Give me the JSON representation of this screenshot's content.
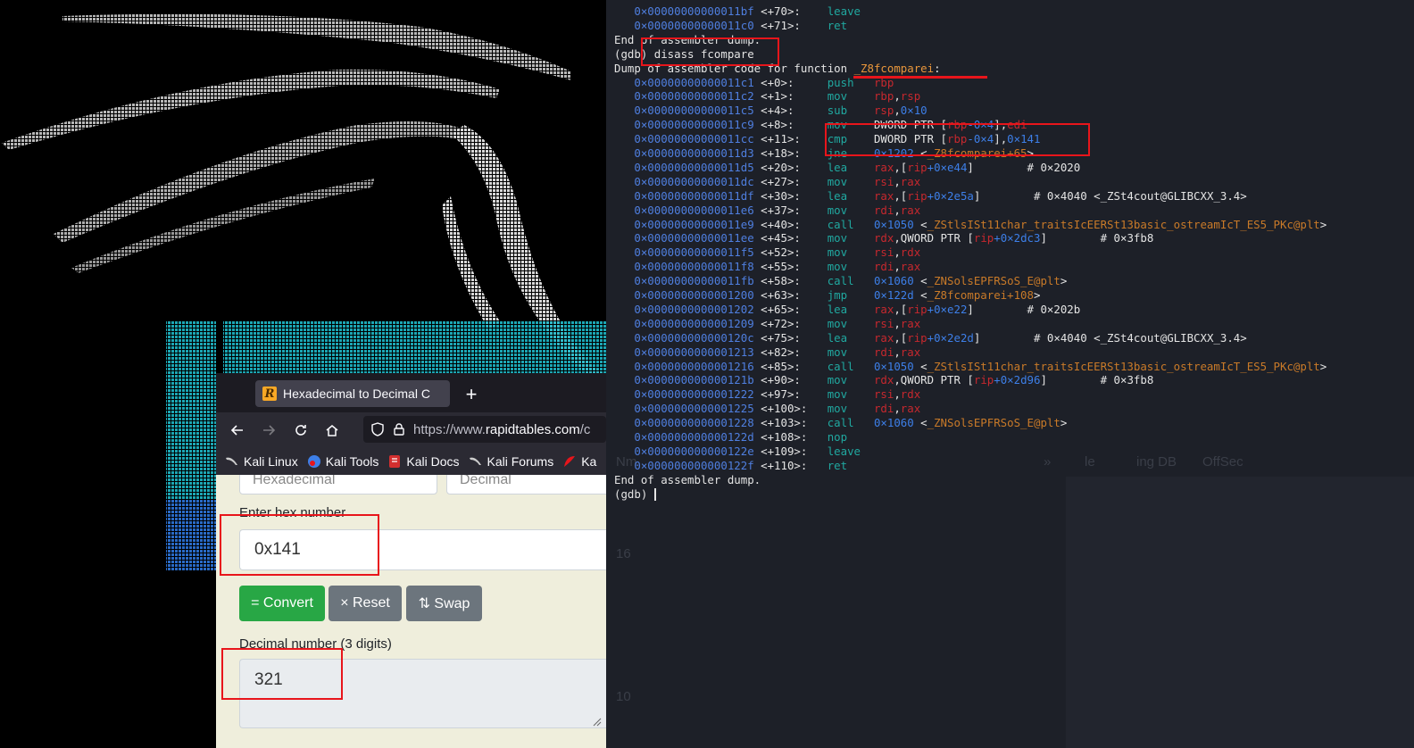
{
  "browser": {
    "tab_title": "Hexadecimal to Decimal C",
    "tab_favicon": "R",
    "new_tab_icon": "+",
    "url_prefix": "https://www.",
    "url_domain": "rapidtables.com",
    "url_rest": "/c",
    "bookmarks": [
      {
        "label": "Kali Linux",
        "icon": "kali-dragon-icon"
      },
      {
        "label": "Kali Tools",
        "icon": "kali-tools-icon"
      },
      {
        "label": "Kali Docs",
        "icon": "kali-docs-icon"
      },
      {
        "label": "Kali Forums",
        "icon": "kali-dragon-icon"
      },
      {
        "label": "Ka",
        "icon": "offsec-icon"
      }
    ]
  },
  "converter": {
    "from_select": "Hexadecimal",
    "to_select": "Decimal",
    "hex_label": "Enter hex number",
    "hex_value": "0x141",
    "convert_label": "= Convert",
    "reset_label": "× Reset",
    "swap_label": "⇅ Swap",
    "decimal_label": "Decimal number (3 digits)",
    "decimal_value": "321"
  },
  "terminal": {
    "ghost_items": {
      "item1": "Nm",
      "item2": "le",
      "item3": "ing DB",
      "item4": "OffSec",
      "item5": "»",
      "num1": "16",
      "num2": "10"
    },
    "lines": [
      [
        [
          "addr",
          "   0×00000000000011bf"
        ],
        [
          "off",
          " <+70>:    "
        ],
        [
          "mn",
          "leave"
        ]
      ],
      [
        [
          "addr",
          "   0×00000000000011c0"
        ],
        [
          "off",
          " <+71>:    "
        ],
        [
          "mn",
          "ret"
        ]
      ],
      [
        [
          "w",
          "End of assembler dump."
        ]
      ],
      [
        [
          "w",
          "(gdb) disass fcompare"
        ]
      ],
      [
        [
          "w",
          "Dump of assembler code for function "
        ],
        [
          "fn",
          "_Z8fcomparei"
        ],
        [
          "w",
          ":"
        ]
      ],
      [
        [
          "addr",
          "   0×00000000000011c1"
        ],
        [
          "off",
          " <+0>:     "
        ],
        [
          "mn",
          "push   "
        ],
        [
          "reg",
          "rbp"
        ]
      ],
      [
        [
          "addr",
          "   0×00000000000011c2"
        ],
        [
          "off",
          " <+1>:     "
        ],
        [
          "mn",
          "mov    "
        ],
        [
          "reg",
          "rbp"
        ],
        [
          "w",
          ","
        ],
        [
          "reg",
          "rsp"
        ]
      ],
      [
        [
          "addr",
          "   0×00000000000011c5"
        ],
        [
          "off",
          " <+4>:     "
        ],
        [
          "mn",
          "sub    "
        ],
        [
          "reg",
          "rsp"
        ],
        [
          "w",
          ","
        ],
        [
          "num",
          "0×10"
        ]
      ],
      [
        [
          "addr",
          "   0×00000000000011c9"
        ],
        [
          "off",
          " <+8>:     "
        ],
        [
          "mn",
          "mov    "
        ],
        [
          "w",
          "DWORD PTR ["
        ],
        [
          "reg",
          "rbp"
        ],
        [
          "num",
          "-0×4"
        ],
        [
          "w",
          "],"
        ],
        [
          "reg",
          "edi"
        ]
      ],
      [
        [
          "addr",
          "   0×00000000000011cc"
        ],
        [
          "off",
          " <+11>:    "
        ],
        [
          "mn",
          "cmp    "
        ],
        [
          "w",
          "DWORD PTR ["
        ],
        [
          "reg",
          "rbp"
        ],
        [
          "num",
          "-0×4"
        ],
        [
          "w",
          "],"
        ],
        [
          "num",
          "0×141"
        ]
      ],
      [
        [
          "addr",
          "   0×00000000000011d3"
        ],
        [
          "off",
          " <+18>:    "
        ],
        [
          "mn",
          "jne    "
        ],
        [
          "num",
          "0×1202 "
        ],
        [
          "w",
          "<"
        ],
        [
          "sym",
          "_Z8fcomparei+65"
        ],
        [
          "w",
          ">"
        ]
      ],
      [
        [
          "addr",
          "   0×00000000000011d5"
        ],
        [
          "off",
          " <+20>:    "
        ],
        [
          "mn",
          "lea    "
        ],
        [
          "reg",
          "rax"
        ],
        [
          "w",
          ",["
        ],
        [
          "reg",
          "rip"
        ],
        [
          "num",
          "+0×e44"
        ],
        [
          "w",
          "]        "
        ],
        [
          "cm",
          "# 0×2020"
        ]
      ],
      [
        [
          "addr",
          "   0×00000000000011dc"
        ],
        [
          "off",
          " <+27>:    "
        ],
        [
          "mn",
          "mov    "
        ],
        [
          "reg",
          "rsi"
        ],
        [
          "w",
          ","
        ],
        [
          "reg",
          "rax"
        ]
      ],
      [
        [
          "addr",
          "   0×00000000000011df"
        ],
        [
          "off",
          " <+30>:    "
        ],
        [
          "mn",
          "lea    "
        ],
        [
          "reg",
          "rax"
        ],
        [
          "w",
          ",["
        ],
        [
          "reg",
          "rip"
        ],
        [
          "num",
          "+0×2e5a"
        ],
        [
          "w",
          "]        "
        ],
        [
          "cm",
          "# 0×4040 <_ZSt4cout@GLIBCXX_3.4>"
        ]
      ],
      [
        [
          "addr",
          "   0×00000000000011e6"
        ],
        [
          "off",
          " <+37>:    "
        ],
        [
          "mn",
          "mov    "
        ],
        [
          "reg",
          "rdi"
        ],
        [
          "w",
          ","
        ],
        [
          "reg",
          "rax"
        ]
      ],
      [
        [
          "addr",
          "   0×00000000000011e9"
        ],
        [
          "off",
          " <+40>:    "
        ],
        [
          "mn",
          "call   "
        ],
        [
          "num",
          "0×1050 "
        ],
        [
          "w",
          "<"
        ],
        [
          "sym",
          "_ZStlsISt11char_traitsIcEERSt13basic_ostreamIcT_ES5_PKc@plt"
        ],
        [
          "w",
          ">"
        ]
      ],
      [
        [
          "addr",
          "   0×00000000000011ee"
        ],
        [
          "off",
          " <+45>:    "
        ],
        [
          "mn",
          "mov    "
        ],
        [
          "reg",
          "rdx"
        ],
        [
          "w",
          ",QWORD PTR ["
        ],
        [
          "reg",
          "rip"
        ],
        [
          "num",
          "+0×2dc3"
        ],
        [
          "w",
          "]        "
        ],
        [
          "cm",
          "# 0×3fb8"
        ]
      ],
      [
        [
          "addr",
          "   0×00000000000011f5"
        ],
        [
          "off",
          " <+52>:    "
        ],
        [
          "mn",
          "mov    "
        ],
        [
          "reg",
          "rsi"
        ],
        [
          "w",
          ","
        ],
        [
          "reg",
          "rdx"
        ]
      ],
      [
        [
          "addr",
          "   0×00000000000011f8"
        ],
        [
          "off",
          " <+55>:    "
        ],
        [
          "mn",
          "mov    "
        ],
        [
          "reg",
          "rdi"
        ],
        [
          "w",
          ","
        ],
        [
          "reg",
          "rax"
        ]
      ],
      [
        [
          "addr",
          "   0×00000000000011fb"
        ],
        [
          "off",
          " <+58>:    "
        ],
        [
          "mn",
          "call   "
        ],
        [
          "num",
          "0×1060 "
        ],
        [
          "w",
          "<"
        ],
        [
          "sym",
          "_ZNSolsEPFRSoS_E@plt"
        ],
        [
          "w",
          ">"
        ]
      ],
      [
        [
          "addr",
          "   0×0000000000001200"
        ],
        [
          "off",
          " <+63>:    "
        ],
        [
          "mn",
          "jmp    "
        ],
        [
          "num",
          "0×122d "
        ],
        [
          "w",
          "<"
        ],
        [
          "sym",
          "_Z8fcomparei+108"
        ],
        [
          "w",
          ">"
        ]
      ],
      [
        [
          "addr",
          "   0×0000000000001202"
        ],
        [
          "off",
          " <+65>:    "
        ],
        [
          "mn",
          "lea    "
        ],
        [
          "reg",
          "rax"
        ],
        [
          "w",
          ",["
        ],
        [
          "reg",
          "rip"
        ],
        [
          "num",
          "+0×e22"
        ],
        [
          "w",
          "]        "
        ],
        [
          "cm",
          "# 0×202b"
        ]
      ],
      [
        [
          "addr",
          "   0×0000000000001209"
        ],
        [
          "off",
          " <+72>:    "
        ],
        [
          "mn",
          "mov    "
        ],
        [
          "reg",
          "rsi"
        ],
        [
          "w",
          ","
        ],
        [
          "reg",
          "rax"
        ]
      ],
      [
        [
          "addr",
          "   0×000000000000120c"
        ],
        [
          "off",
          " <+75>:    "
        ],
        [
          "mn",
          "lea    "
        ],
        [
          "reg",
          "rax"
        ],
        [
          "w",
          ",["
        ],
        [
          "reg",
          "rip"
        ],
        [
          "num",
          "+0×2e2d"
        ],
        [
          "w",
          "]        "
        ],
        [
          "cm",
          "# 0×4040 <_ZSt4cout@GLIBCXX_3.4>"
        ]
      ],
      [
        [
          "addr",
          "   0×0000000000001213"
        ],
        [
          "off",
          " <+82>:    "
        ],
        [
          "mn",
          "mov    "
        ],
        [
          "reg",
          "rdi"
        ],
        [
          "w",
          ","
        ],
        [
          "reg",
          "rax"
        ]
      ],
      [
        [
          "addr",
          "   0×0000000000001216"
        ],
        [
          "off",
          " <+85>:    "
        ],
        [
          "mn",
          "call   "
        ],
        [
          "num",
          "0×1050 "
        ],
        [
          "w",
          "<"
        ],
        [
          "sym",
          "_ZStlsISt11char_traitsIcEERSt13basic_ostreamIcT_ES5_PKc@plt"
        ],
        [
          "w",
          ">"
        ]
      ],
      [
        [
          "addr",
          "   0×000000000000121b"
        ],
        [
          "off",
          " <+90>:    "
        ],
        [
          "mn",
          "mov    "
        ],
        [
          "reg",
          "rdx"
        ],
        [
          "w",
          ",QWORD PTR ["
        ],
        [
          "reg",
          "rip"
        ],
        [
          "num",
          "+0×2d96"
        ],
        [
          "w",
          "]        "
        ],
        [
          "cm",
          "# 0×3fb8"
        ]
      ],
      [
        [
          "addr",
          "   0×0000000000001222"
        ],
        [
          "off",
          " <+97>:    "
        ],
        [
          "mn",
          "mov    "
        ],
        [
          "reg",
          "rsi"
        ],
        [
          "w",
          ","
        ],
        [
          "reg",
          "rdx"
        ]
      ],
      [
        [
          "addr",
          "   0×0000000000001225"
        ],
        [
          "off",
          " <+100>:   "
        ],
        [
          "mn",
          "mov    "
        ],
        [
          "reg",
          "rdi"
        ],
        [
          "w",
          ","
        ],
        [
          "reg",
          "rax"
        ]
      ],
      [
        [
          "addr",
          "   0×0000000000001228"
        ],
        [
          "off",
          " <+103>:   "
        ],
        [
          "mn",
          "call   "
        ],
        [
          "num",
          "0×1060 "
        ],
        [
          "w",
          "<"
        ],
        [
          "sym",
          "_ZNSolsEPFRSoS_E@plt"
        ],
        [
          "w",
          ">"
        ]
      ],
      [
        [
          "addr",
          "   0×000000000000122d"
        ],
        [
          "off",
          " <+108>:   "
        ],
        [
          "mn",
          "nop"
        ]
      ],
      [
        [
          "addr",
          "   0×000000000000122e"
        ],
        [
          "off",
          " <+109>:   "
        ],
        [
          "mn",
          "leave"
        ]
      ],
      [
        [
          "addr",
          "   0×000000000000122f"
        ],
        [
          "off",
          " <+110>:   "
        ],
        [
          "mn",
          "ret"
        ]
      ],
      [
        [
          "w",
          "End of assembler dump."
        ]
      ],
      [
        [
          "w",
          "(gdb) "
        ]
      ]
    ]
  },
  "colors": {
    "annotation": "#e8151b",
    "terminal_bg": "#1d2028",
    "convert_green": "#28a745",
    "secondary_gray": "#6c757d"
  }
}
